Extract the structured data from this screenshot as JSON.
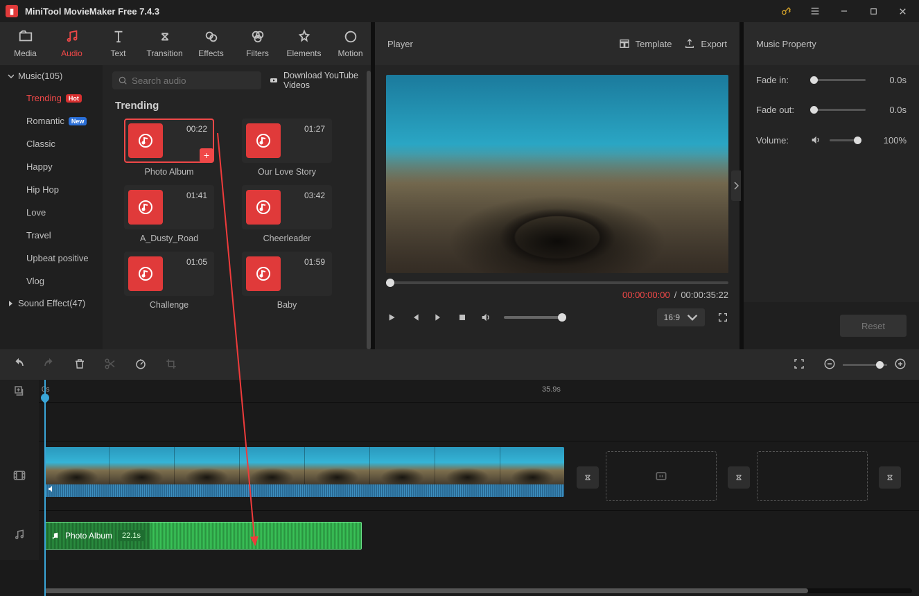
{
  "titlebar": {
    "app_title": "MiniTool MovieMaker Free 7.4.3"
  },
  "tabs": {
    "media": "Media",
    "audio": "Audio",
    "text": "Text",
    "transition": "Transition",
    "effects": "Effects",
    "filters": "Filters",
    "elements": "Elements",
    "motion": "Motion"
  },
  "sidebar": {
    "music_header": "Music(105)",
    "items": [
      {
        "label": "Trending",
        "badge": "Hot",
        "active": true
      },
      {
        "label": "Romantic",
        "badge": "New"
      },
      {
        "label": "Classic"
      },
      {
        "label": "Happy"
      },
      {
        "label": "Hip Hop"
      },
      {
        "label": "Love"
      },
      {
        "label": "Travel"
      },
      {
        "label": "Upbeat positive"
      },
      {
        "label": "Vlog"
      }
    ],
    "sound_effect_header": "Sound Effect(47)"
  },
  "search": {
    "placeholder": "Search audio"
  },
  "download_yt": "Download YouTube Videos",
  "grid": {
    "section_title": "Trending",
    "items": [
      {
        "duration": "00:22",
        "label": "Photo Album",
        "selected": true,
        "add": true
      },
      {
        "duration": "01:27",
        "label": "Our Love Story"
      },
      {
        "duration": "01:41",
        "label": "A_Dusty_Road"
      },
      {
        "duration": "03:42",
        "label": "Cheerleader"
      },
      {
        "duration": "01:05",
        "label": "Challenge"
      },
      {
        "duration": "01:59",
        "label": "Baby"
      }
    ]
  },
  "player": {
    "title": "Player",
    "template": "Template",
    "export": "Export",
    "current_time": "00:00:00:00",
    "sep": "/",
    "total_time": "00:00:35:22",
    "ratio": "16:9"
  },
  "property": {
    "title": "Music Property",
    "fade_in": {
      "label": "Fade in:",
      "value": "0.0s"
    },
    "fade_out": {
      "label": "Fade out:",
      "value": "0.0s"
    },
    "volume": {
      "label": "Volume:",
      "value": "100%"
    },
    "reset": "Reset"
  },
  "timeline": {
    "ruler": {
      "start": "0s",
      "end": "35.9s"
    },
    "audio_clip": {
      "name": "Photo Album",
      "length": "22.1s"
    }
  }
}
